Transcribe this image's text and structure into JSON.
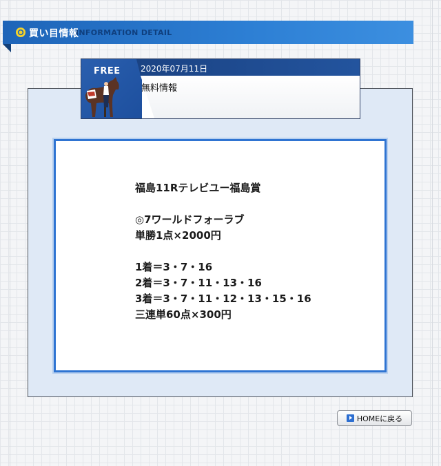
{
  "header": {
    "title": "買い目情報",
    "subtitle": "INFORMATION DETAIL",
    "icon": "double-circle-icon"
  },
  "card": {
    "badge": "FREE",
    "date": "2020年07月11日",
    "title": "無料情報"
  },
  "post": {
    "race": "福島11Rテレビユー福島賞",
    "pick": "◎7ワールドフォーラブ",
    "win_bet": "単勝1点×2000円",
    "first": "1着＝3・7・16",
    "second": "2着＝3・7・11・13・16",
    "third": "3着＝3・7・11・12・13・15・16",
    "trifecta_bet": "三連単60点×300円"
  },
  "footer": {
    "home_label": "HOMEに戻る",
    "home_icon": "play-arrow-icon"
  },
  "colors": {
    "header_blue": "#1e64b8",
    "accent_yellow": "#f5d22a",
    "frame_blue": "#2f74d2"
  }
}
